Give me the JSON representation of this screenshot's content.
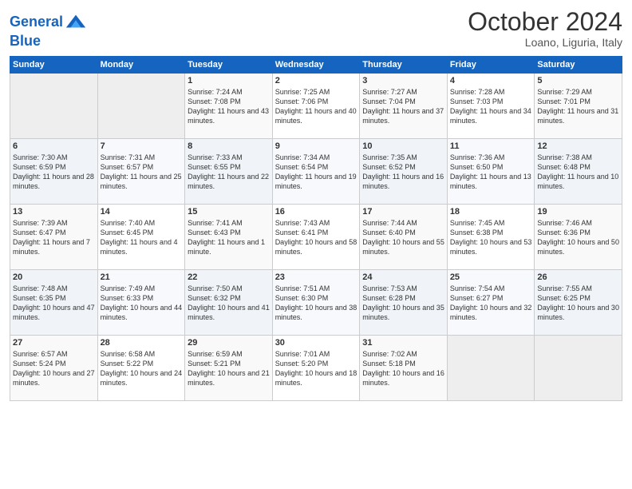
{
  "header": {
    "logo_line1": "General",
    "logo_line2": "Blue",
    "month": "October 2024",
    "location": "Loano, Liguria, Italy"
  },
  "days_of_week": [
    "Sunday",
    "Monday",
    "Tuesday",
    "Wednesday",
    "Thursday",
    "Friday",
    "Saturday"
  ],
  "weeks": [
    [
      {
        "day": "",
        "info": ""
      },
      {
        "day": "",
        "info": ""
      },
      {
        "day": "1",
        "info": "Sunrise: 7:24 AM\nSunset: 7:08 PM\nDaylight: 11 hours and 43 minutes."
      },
      {
        "day": "2",
        "info": "Sunrise: 7:25 AM\nSunset: 7:06 PM\nDaylight: 11 hours and 40 minutes."
      },
      {
        "day": "3",
        "info": "Sunrise: 7:27 AM\nSunset: 7:04 PM\nDaylight: 11 hours and 37 minutes."
      },
      {
        "day": "4",
        "info": "Sunrise: 7:28 AM\nSunset: 7:03 PM\nDaylight: 11 hours and 34 minutes."
      },
      {
        "day": "5",
        "info": "Sunrise: 7:29 AM\nSunset: 7:01 PM\nDaylight: 11 hours and 31 minutes."
      }
    ],
    [
      {
        "day": "6",
        "info": "Sunrise: 7:30 AM\nSunset: 6:59 PM\nDaylight: 11 hours and 28 minutes."
      },
      {
        "day": "7",
        "info": "Sunrise: 7:31 AM\nSunset: 6:57 PM\nDaylight: 11 hours and 25 minutes."
      },
      {
        "day": "8",
        "info": "Sunrise: 7:33 AM\nSunset: 6:55 PM\nDaylight: 11 hours and 22 minutes."
      },
      {
        "day": "9",
        "info": "Sunrise: 7:34 AM\nSunset: 6:54 PM\nDaylight: 11 hours and 19 minutes."
      },
      {
        "day": "10",
        "info": "Sunrise: 7:35 AM\nSunset: 6:52 PM\nDaylight: 11 hours and 16 minutes."
      },
      {
        "day": "11",
        "info": "Sunrise: 7:36 AM\nSunset: 6:50 PM\nDaylight: 11 hours and 13 minutes."
      },
      {
        "day": "12",
        "info": "Sunrise: 7:38 AM\nSunset: 6:48 PM\nDaylight: 11 hours and 10 minutes."
      }
    ],
    [
      {
        "day": "13",
        "info": "Sunrise: 7:39 AM\nSunset: 6:47 PM\nDaylight: 11 hours and 7 minutes."
      },
      {
        "day": "14",
        "info": "Sunrise: 7:40 AM\nSunset: 6:45 PM\nDaylight: 11 hours and 4 minutes."
      },
      {
        "day": "15",
        "info": "Sunrise: 7:41 AM\nSunset: 6:43 PM\nDaylight: 11 hours and 1 minute."
      },
      {
        "day": "16",
        "info": "Sunrise: 7:43 AM\nSunset: 6:41 PM\nDaylight: 10 hours and 58 minutes."
      },
      {
        "day": "17",
        "info": "Sunrise: 7:44 AM\nSunset: 6:40 PM\nDaylight: 10 hours and 55 minutes."
      },
      {
        "day": "18",
        "info": "Sunrise: 7:45 AM\nSunset: 6:38 PM\nDaylight: 10 hours and 53 minutes."
      },
      {
        "day": "19",
        "info": "Sunrise: 7:46 AM\nSunset: 6:36 PM\nDaylight: 10 hours and 50 minutes."
      }
    ],
    [
      {
        "day": "20",
        "info": "Sunrise: 7:48 AM\nSunset: 6:35 PM\nDaylight: 10 hours and 47 minutes."
      },
      {
        "day": "21",
        "info": "Sunrise: 7:49 AM\nSunset: 6:33 PM\nDaylight: 10 hours and 44 minutes."
      },
      {
        "day": "22",
        "info": "Sunrise: 7:50 AM\nSunset: 6:32 PM\nDaylight: 10 hours and 41 minutes."
      },
      {
        "day": "23",
        "info": "Sunrise: 7:51 AM\nSunset: 6:30 PM\nDaylight: 10 hours and 38 minutes."
      },
      {
        "day": "24",
        "info": "Sunrise: 7:53 AM\nSunset: 6:28 PM\nDaylight: 10 hours and 35 minutes."
      },
      {
        "day": "25",
        "info": "Sunrise: 7:54 AM\nSunset: 6:27 PM\nDaylight: 10 hours and 32 minutes."
      },
      {
        "day": "26",
        "info": "Sunrise: 7:55 AM\nSunset: 6:25 PM\nDaylight: 10 hours and 30 minutes."
      }
    ],
    [
      {
        "day": "27",
        "info": "Sunrise: 6:57 AM\nSunset: 5:24 PM\nDaylight: 10 hours and 27 minutes."
      },
      {
        "day": "28",
        "info": "Sunrise: 6:58 AM\nSunset: 5:22 PM\nDaylight: 10 hours and 24 minutes."
      },
      {
        "day": "29",
        "info": "Sunrise: 6:59 AM\nSunset: 5:21 PM\nDaylight: 10 hours and 21 minutes."
      },
      {
        "day": "30",
        "info": "Sunrise: 7:01 AM\nSunset: 5:20 PM\nDaylight: 10 hours and 18 minutes."
      },
      {
        "day": "31",
        "info": "Sunrise: 7:02 AM\nSunset: 5:18 PM\nDaylight: 10 hours and 16 minutes."
      },
      {
        "day": "",
        "info": ""
      },
      {
        "day": "",
        "info": ""
      }
    ]
  ]
}
